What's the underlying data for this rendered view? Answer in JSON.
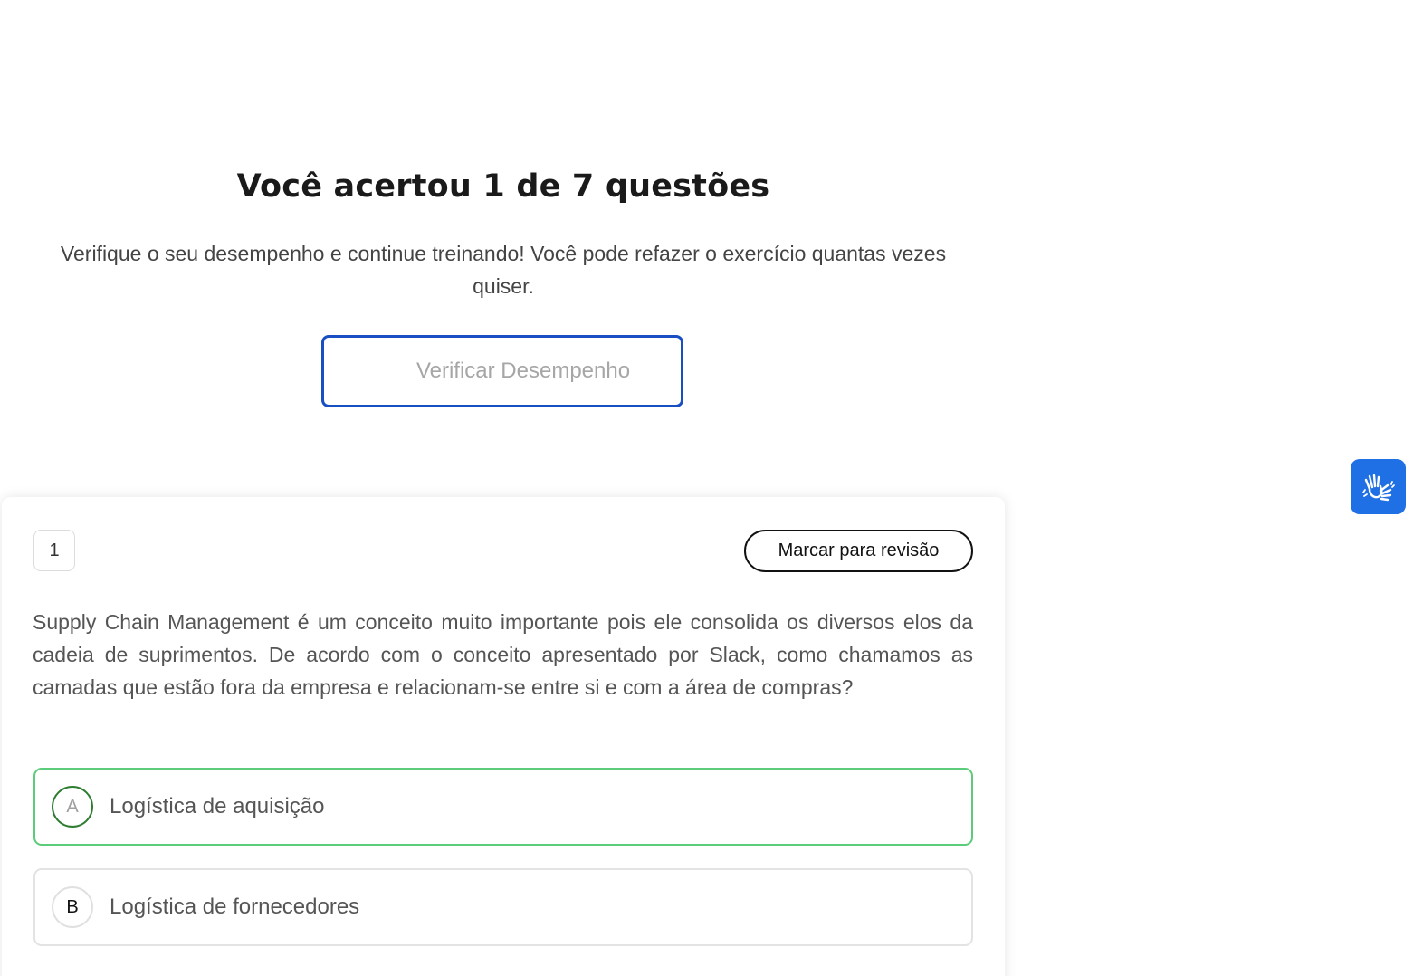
{
  "result": {
    "title": "Você acertou 1 de 7 questões",
    "subtitle": "Verifique o seu desempenho e continue treinando! Você pode refazer o exercício quantas vezes quiser.",
    "verify_button_label": "Verificar Desempenho"
  },
  "accessibility": {
    "icon": "sign-language-hands-icon",
    "color": "#1f6fe5"
  },
  "question": {
    "number": "1",
    "review_button_label": "Marcar para revisão",
    "text": "Supply Chain Management é um conceito muito importante pois ele consolida os diversos elos da cadeia de suprimentos. De acordo com o conceito apresentado por Slack, como chamamos as camadas que estão fora da empresa e relacionam-se entre si e com a área de compras?",
    "options": [
      {
        "letter": "A",
        "text": "Logística de aquisição",
        "state": "correct"
      },
      {
        "letter": "B",
        "text": "Logística de fornecedores",
        "state": "normal"
      }
    ]
  },
  "colors": {
    "primary_blue": "#1a4fc4",
    "correct_green": "#5dcc7a",
    "dark_green": "#2e7d32"
  }
}
